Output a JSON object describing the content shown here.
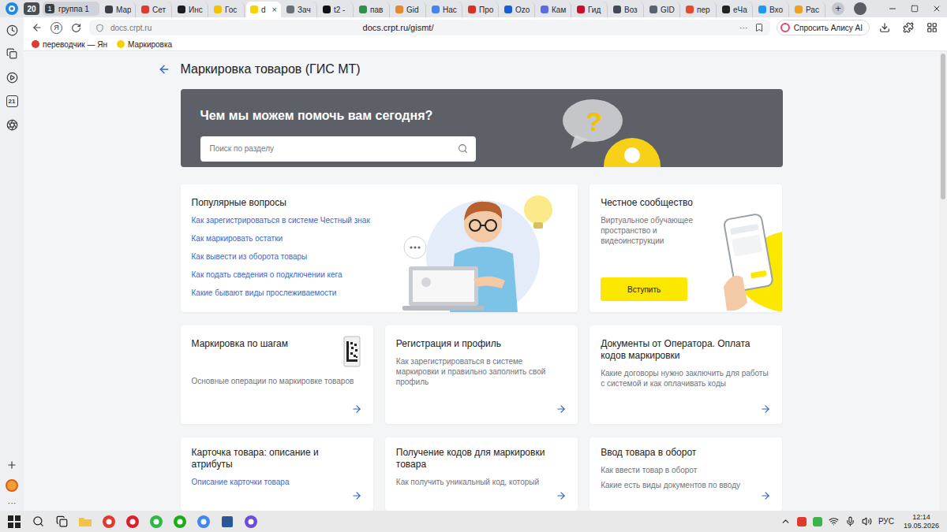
{
  "browser": {
    "tab_count": "20",
    "group": {
      "number": "1",
      "label": "группа 1"
    },
    "close": "×",
    "new_tab": "+",
    "tabs": [
      {
        "label": "Мар",
        "selected": false,
        "color": "#3b3f46"
      },
      {
        "label": "Сет",
        "selected": false,
        "color": "#e03a2f"
      },
      {
        "label": "Инс",
        "selected": false,
        "color": "#1d1d1f"
      },
      {
        "label": "Гос",
        "selected": false,
        "color": "#f2c200"
      },
      {
        "label": "d",
        "selected": true,
        "color": "#f5d200"
      },
      {
        "label": "Зач",
        "selected": false,
        "color": "#6a6f78"
      },
      {
        "label": "t2 -",
        "selected": false,
        "color": "#111111"
      },
      {
        "label": "пав",
        "selected": false,
        "color": "#2f8f4e"
      },
      {
        "label": "Gid",
        "selected": false,
        "color": "#e8882c"
      },
      {
        "label": "Нас",
        "selected": false,
        "color": "#4285f4"
      },
      {
        "label": "Про",
        "selected": false,
        "color": "#d93025"
      },
      {
        "label": "Ozo",
        "selected": false,
        "color": "#1a5bd6"
      },
      {
        "label": "Кам",
        "selected": false,
        "color": "#5b6be0"
      },
      {
        "label": "Гид",
        "selected": false,
        "color": "#c8102e"
      },
      {
        "label": "Воз",
        "selected": false,
        "color": "#444a55"
      },
      {
        "label": "GID",
        "selected": false,
        "color": "#5a6270"
      },
      {
        "label": "пер",
        "selected": false,
        "color": "#e64a2e"
      },
      {
        "label": "еЧа",
        "selected": false,
        "color": "#222222"
      },
      {
        "label": "Вхо",
        "selected": false,
        "color": "#2196f3"
      },
      {
        "label": "Рас",
        "selected": false,
        "color": "#f0a020"
      }
    ]
  },
  "address_bar": {
    "yandex": "Я",
    "site": "docs.crpt.ru",
    "url": "docs.crpt.ru/gismt/",
    "more": "···",
    "alice": "Спросить Алису AI"
  },
  "bookmarks": [
    {
      "label": "переводчик — Ян",
      "color": "#e03a2f"
    },
    {
      "label": "Маркировка",
      "color": "#f5d200"
    }
  ],
  "sidebar": {
    "calendar_day": "21",
    "more": "···"
  },
  "page": {
    "title": "Маркировка товаров (ГИС МТ)",
    "hero": {
      "title": "Чем мы можем помочь вам сегодня?",
      "search_placeholder": "Поиск по разделу",
      "mark": "?"
    },
    "popular": {
      "title": "Популярные вопросы",
      "links": [
        "Как зарегистрироваться в системе Честный знак",
        "Как маркировать остатки",
        "Как вывести из оборота товары",
        "Как подать сведения о подключении кега",
        "Какие бывают виды прослеживаемости"
      ]
    },
    "community": {
      "title": "Честное сообщество",
      "description": "Виртуальное обучающее пространство и видеоинструкции",
      "button": "Вступить"
    },
    "sections": [
      {
        "title": "Маркировка по шагам",
        "items": [
          {
            "text": "Основные операции по маркировке товаров",
            "kind": "text"
          }
        ]
      },
      {
        "title": "Регистрация и профиль",
        "items": [
          {
            "text": "Как зарегистрироваться в системе маркировки и правильно заполнить свой профиль",
            "kind": "text"
          }
        ]
      },
      {
        "title": "Документы от Оператора. Оплата кодов маркировки",
        "items": [
          {
            "text": "Какие договоры нужно заключить для работы с системой и как оплачивать коды",
            "kind": "text"
          }
        ]
      },
      {
        "title": "Карточка товара: описание и атрибуты",
        "items": [
          {
            "text": "Описание карточки товара",
            "kind": "link"
          }
        ]
      },
      {
        "title": "Получение кодов для маркировки товара",
        "items": [
          {
            "text": "Как получить уникальный код, который",
            "kind": "text"
          }
        ]
      },
      {
        "title": "Ввод товара в оборот",
        "items": [
          {
            "text": "Как ввести товар в оборот",
            "kind": "text"
          },
          {
            "text": "Какие есть виды документов по вводу",
            "kind": "text"
          }
        ]
      }
    ]
  },
  "scrollbar": {
    "level": 0.32
  },
  "taskbar": {
    "language": "РУС",
    "time": "12:14",
    "date": "19.05.2026"
  }
}
